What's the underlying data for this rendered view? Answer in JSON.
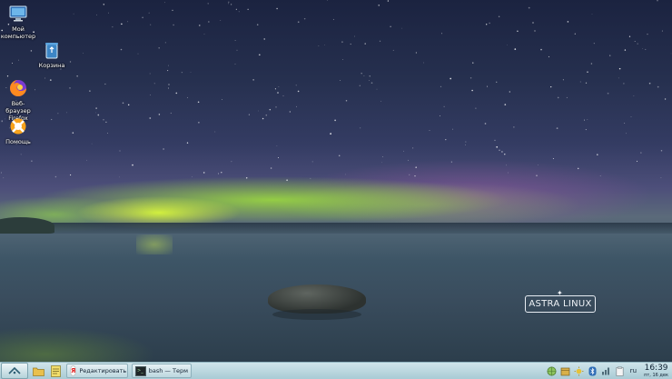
{
  "desktop": {
    "icons": [
      {
        "label": "Мой компьютер"
      },
      {
        "label": "Корзина"
      },
      {
        "label": "Веб-браузер Firefox"
      },
      {
        "label": "Помощь"
      }
    ],
    "wallpaper_brand": "ASTRA LINUX"
  },
  "taskbar": {
    "tasks": [
      {
        "label": "Редактировать д",
        "icon": "yandex-browser-icon"
      },
      {
        "label": "bash — Терм",
        "icon": "terminal-icon"
      }
    ],
    "language": "ru",
    "clock_time": "16:39",
    "clock_date": "пт, 16 дек"
  },
  "colors": {
    "taskbar": "#b9d7df",
    "aurora": "#b8e34a"
  }
}
